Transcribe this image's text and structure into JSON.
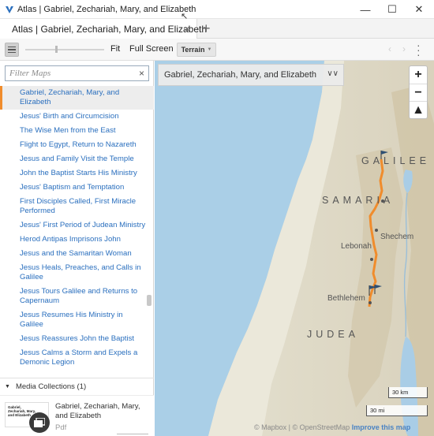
{
  "window": {
    "title": "Atlas | Gabriel, Zechariah, Mary, and Elizabeth",
    "min_icon": "minimize-icon",
    "max_icon": "maximize-icon",
    "close_icon": "close-icon"
  },
  "tabs": [
    {
      "label": "Atlas | Gabriel, Zechariah, Mary, and Elizabeth",
      "icon": "map-pin-icon",
      "close": "×"
    }
  ],
  "tab_add": "+",
  "toolbar": {
    "fit_label": "Fit",
    "fullscreen_label": "Full Screen",
    "map_style": "Terrain",
    "back": "‹",
    "forward": "›"
  },
  "sidebar": {
    "filter_placeholder": "Filter Maps",
    "filter_clear": "×",
    "maps": [
      "Gabriel, Zechariah, Mary, and Elizabeth",
      "Jesus' Birth and Circumcision",
      "The Wise Men from the East",
      "Flight to Egypt, Return to Nazareth",
      "Jesus and Family Visit the Temple",
      "John the Baptist Starts His Ministry",
      "Jesus' Baptism and Temptation",
      "First Disciples Called, First Miracle Performed",
      "Jesus' First Period of Judean Ministry",
      "Herod Antipas Imprisons John",
      "Jesus and the Samaritan Woman",
      "Jesus Heals, Preaches, and Calls in Galilee",
      "Jesus Tours Galilee and Returns to Capernaum",
      "Jesus Resumes His Ministry in Galilee",
      "Jesus Reassures John the Baptist",
      "Jesus Calms a Storm and Expels a Demonic Legion"
    ],
    "active_index": 0,
    "media_collections_label": "Media Collections (1)",
    "media": {
      "title": "Gabriel, Zechariah, Mary, and Elizabeth",
      "type": "Pdf",
      "thumb_text": "Gabriel, Zechariah, Mary, and Elizabeth"
    }
  },
  "map": {
    "title": "Gabriel, Zechariah, Mary, and Elizabeth",
    "zoom_in": "+",
    "zoom_out": "−",
    "compass": "▲",
    "regions": [
      "GALILEE",
      "SAMARIA",
      "JUDEA"
    ],
    "places": [
      "Shechem",
      "Lebonah",
      "Bethlehem"
    ],
    "scale_km": "30 km",
    "scale_mi": "30 mi",
    "attribution_mapbox": "© Mapbox",
    "attribution_sep": " | ",
    "attribution_osm": "© OpenStreetMap",
    "improve": "Improve this map",
    "colors": {
      "route": "#f08c2c",
      "sea": "#a9cde6",
      "land": "#e4e2d4"
    }
  }
}
